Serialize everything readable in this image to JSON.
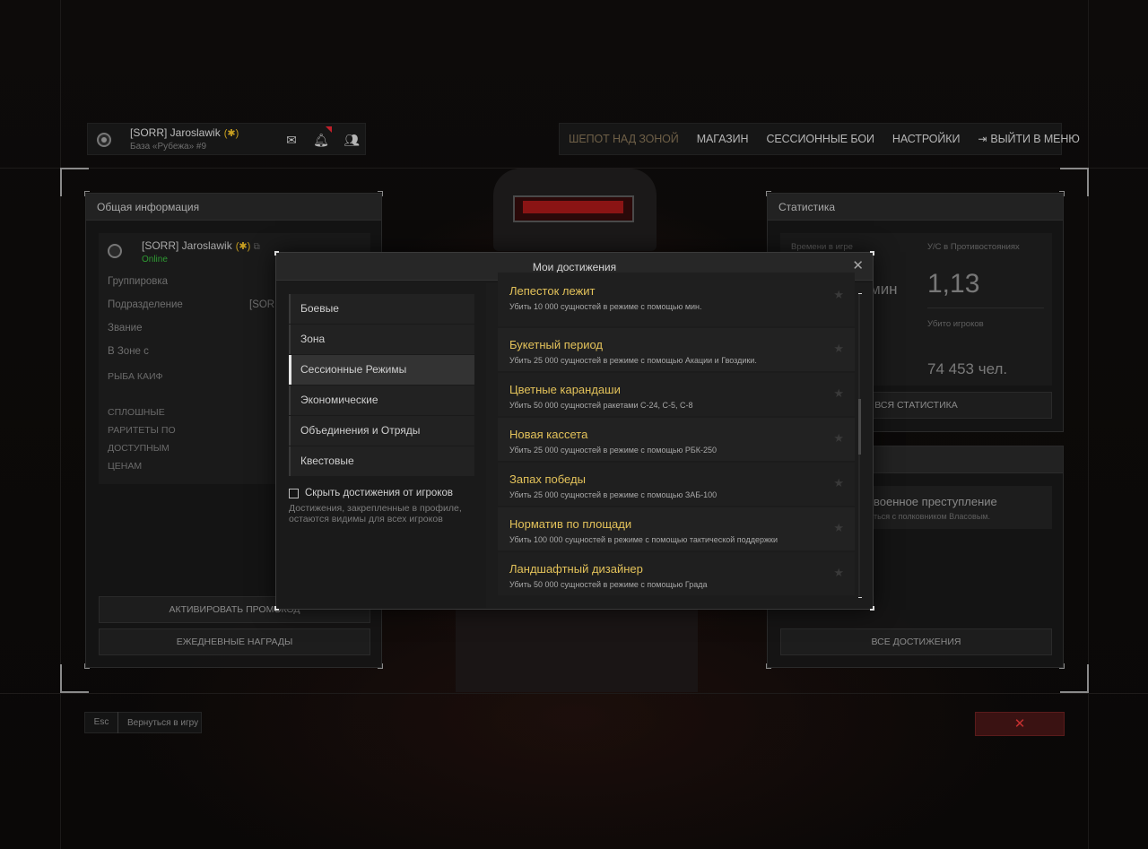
{
  "topbar": {
    "player_name": "[SORR] Jaroslawik",
    "base": "База «Рубежа» #9",
    "nav": [
      "ШЕПОТ НАД ЗОНОЙ",
      "МАГАЗИН",
      "СЕССИОННЫЕ БОИ",
      "НАСТРОЙКИ"
    ],
    "exit_menu": "ВЫЙТИ В МЕНЮ"
  },
  "left_panel": {
    "title": "Общая информация",
    "player_name": "[SORR] Jaroslawik",
    "status": "Online",
    "rows": [
      {
        "label": "Группировка",
        "value": ""
      },
      {
        "label": "Подразделение",
        "value": "[SORR]"
      },
      {
        "label": "Звание",
        "value": ""
      },
      {
        "label": "В Зоне с",
        "value": ""
      }
    ],
    "motto": "РЫБА КАИФ",
    "caps_lines": [
      "СПЛОШНЫЕ",
      "РАРИТЕТЫ ПО",
      "ДОСТУПНЫМ",
      "ЦЕНАМ"
    ],
    "promo_button": "АКТИВИРОВАТЬ ПРОМОКОД",
    "daily_button": "ЕЖЕДНЕВНЫЕ НАГРАДЫ"
  },
  "right_panel": {
    "title": "Статистика",
    "time_label": "Времени в игре",
    "time_value": "мин",
    "kd_label": "У/С в Противостояниях",
    "kd_value": "1,13",
    "kills_label": "Убито игроков",
    "kills_value": "74 453 чел.",
    "all_stats": "ВСЯ СТАТИСТИКА",
    "achievement_title": "военное преступление",
    "achievement_desc": "ться с полковником Власовым.",
    "all_achievements": "ВСЕ ДОСТИЖЕНИЯ"
  },
  "bottom": {
    "esc_key": "Esc",
    "esc_label": "Вернуться в игру"
  },
  "modal": {
    "title": "Мои достижения",
    "categories": [
      "Боевые",
      "Зона",
      "Сессионные Режимы",
      "Экономические",
      "Объединения и Отряды",
      "Квестовые"
    ],
    "active_category": "Сессионные Режимы",
    "hide_label": "Скрыть достижения от игроков",
    "hide_note": "Достижения, закрепленные в профиле, остаются видимы для всех игроков",
    "achievements": [
      {
        "title": "Лепесток лежит",
        "desc": "Убить 10 000 сущностей в режиме с помощью мин."
      },
      {
        "title": "Букетный период",
        "desc": "Убить 25 000 сущностей в режиме с помощью Акации и Гвоздики."
      },
      {
        "title": "Цветные карандаши",
        "desc": "Убить 50 000 сущностей ракетами С-24, С-5, С-8"
      },
      {
        "title": "Новая кассета",
        "desc": "Убить 25 000 сущностей в режиме с помощью РБК-250"
      },
      {
        "title": "Запах победы",
        "desc": "Убить 25 000 сущностей в режиме с помощью ЗАБ-100"
      },
      {
        "title": "Норматив по площади",
        "desc": "Убить 100 000 сущностей в режиме с помощью тактической поддержки"
      },
      {
        "title": "Ландшафтный дизайнер",
        "desc": "Убить 50 000 сущностей в режиме с помощью Града"
      }
    ]
  },
  "colors": {
    "achievement_title": "#e3c25a",
    "online": "#2e9a32",
    "nav_active": "#6e5f47",
    "exit_red": "#c53030"
  }
}
